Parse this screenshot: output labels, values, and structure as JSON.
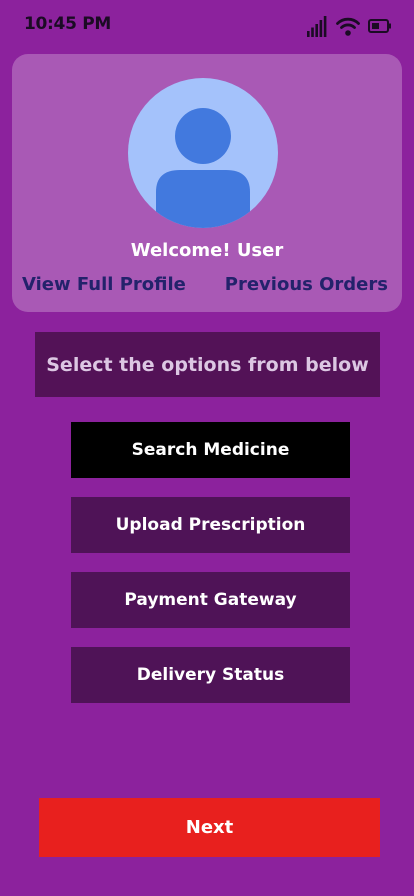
{
  "status_bar": {
    "time": "10:45 PM",
    "icons": [
      "signal-icon",
      "wifi-icon",
      "battery-icon"
    ]
  },
  "profile": {
    "welcome": "Welcome! User",
    "view_profile": "View Full Profile",
    "previous_orders": "Previous Orders"
  },
  "options": {
    "heading": "Select the options from below",
    "items": [
      {
        "label": "Search Medicine"
      },
      {
        "label": "Upload Prescription"
      },
      {
        "label": "Payment Gateway"
      },
      {
        "label": "Delivery Status"
      }
    ]
  },
  "next_label": "Next",
  "colors": {
    "background": "#8c229d",
    "card": "#b46bc2",
    "panel": "#531257",
    "active_option": "#000000",
    "next": "#e8201e",
    "link": "#23226b",
    "avatar_bg": "#a4c2fb",
    "avatar_fg": "#4279de"
  }
}
